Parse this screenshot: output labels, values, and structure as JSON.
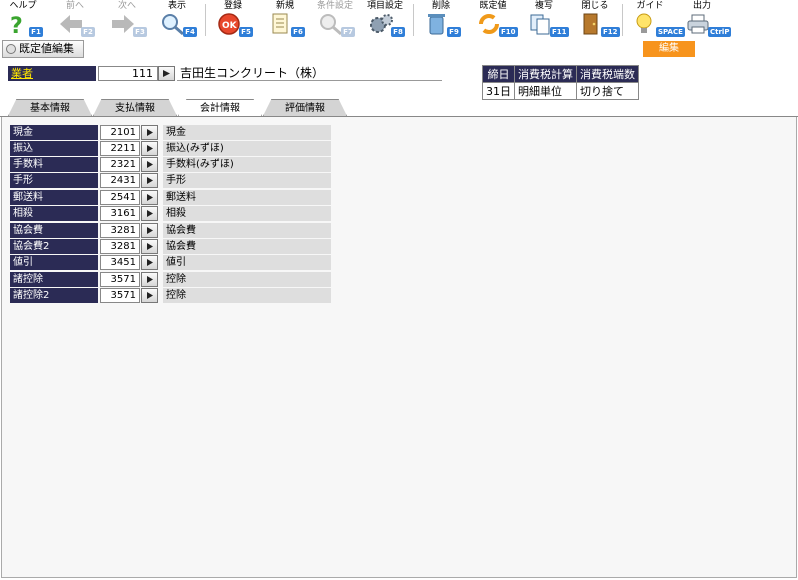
{
  "toolbar": {
    "buttons": [
      {
        "label": "ヘルプ",
        "key": "F1",
        "icon": "help-icon",
        "disabled": false
      },
      {
        "label": "前へ",
        "key": "F2",
        "icon": "arrow-left-icon",
        "disabled": true
      },
      {
        "label": "次へ",
        "key": "F3",
        "icon": "arrow-right-icon",
        "disabled": true
      },
      {
        "label": "表示",
        "key": "F4",
        "icon": "magnifier-icon",
        "disabled": false
      },
      {
        "label": "登録",
        "key": "F5",
        "icon": "ok-icon",
        "disabled": false
      },
      {
        "label": "新規",
        "key": "F6",
        "icon": "new-document-icon",
        "disabled": false
      },
      {
        "label": "条件設定",
        "key": "F7",
        "icon": "magnifier-gear-icon",
        "disabled": true
      },
      {
        "label": "項目設定",
        "key": "F8",
        "icon": "gears-icon",
        "disabled": false
      },
      {
        "label": "削除",
        "key": "F9",
        "icon": "trash-icon",
        "disabled": false
      },
      {
        "label": "既定値",
        "key": "F10",
        "icon": "refresh-icon",
        "disabled": false
      },
      {
        "label": "複写",
        "key": "F11",
        "icon": "copy-icon",
        "disabled": false
      },
      {
        "label": "閉じる",
        "key": "F12",
        "icon": "door-icon",
        "disabled": false
      },
      {
        "label": "ガイド",
        "key": "SPACE",
        "icon": "lightbulb-icon",
        "disabled": false
      },
      {
        "label": "出力",
        "key": "CtrlP",
        "icon": "print-icon",
        "disabled": false
      }
    ]
  },
  "title": "既定値編集",
  "mode_badge": "編集",
  "vendor": {
    "label": "業者",
    "code": "111",
    "name": "吉田生コンクリート（株）"
  },
  "info_table": {
    "headers": [
      "締日",
      "消費税計算",
      "消費税端数"
    ],
    "values": [
      "31日",
      "明細単位",
      "切り捨て"
    ]
  },
  "tabs": [
    {
      "label": "基本情報",
      "active": false
    },
    {
      "label": "支払情報",
      "active": false
    },
    {
      "label": "会計情報",
      "active": true
    },
    {
      "label": "評価情報",
      "active": false
    }
  ],
  "accounts": [
    {
      "label": "現金",
      "code": "2101",
      "name": "現金"
    },
    {
      "label": "振込",
      "code": "2211",
      "name": "振込(みずほ)"
    },
    {
      "label": "手数料",
      "code": "2321",
      "name": "手数料(みずほ)"
    },
    {
      "label": "手形",
      "code": "2431",
      "name": "手形"
    },
    {
      "label": "郵送料",
      "code": "2541",
      "name": "郵送料"
    },
    {
      "label": "相殺",
      "code": "3161",
      "name": "相殺"
    },
    {
      "label": "協会費",
      "code": "3281",
      "name": "協会費"
    },
    {
      "label": "協会費2",
      "code": "3281",
      "name": "協会費"
    },
    {
      "label": "値引",
      "code": "3451",
      "name": "値引"
    },
    {
      "label": "諸控除",
      "code": "3571",
      "name": "控除"
    },
    {
      "label": "諸控除2",
      "code": "3571",
      "name": "控除"
    }
  ],
  "colors": {
    "header_bg": "#2b2b55",
    "badge": "#f7941d",
    "accent_key": "#2f7ed8",
    "vendor_label_text": "#ffe600"
  }
}
